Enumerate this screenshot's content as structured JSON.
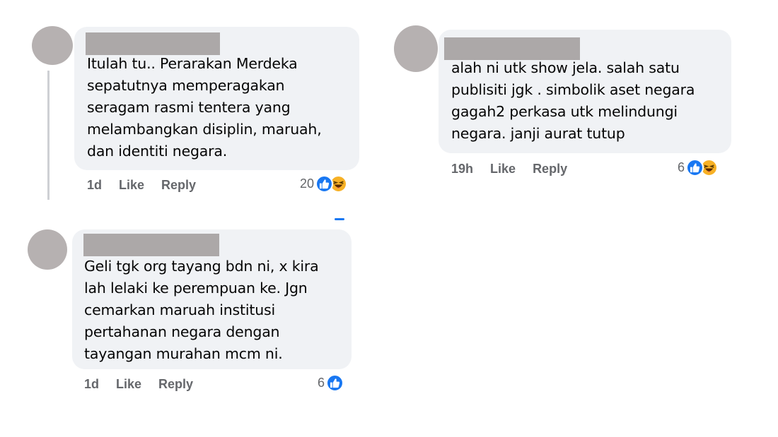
{
  "comments": [
    {
      "text_lines": [
        "Itulah tu.. Perarakan Merdeka",
        "sepatutnya memperagakan",
        "seragam rasmi tentera yang",
        "melambangkan disiplin, maruah,",
        "dan identiti negara."
      ],
      "time": "1d",
      "like_label": "Like",
      "reply_label": "Reply",
      "reaction_count": "20",
      "reactions": [
        "like-icon",
        "haha-icon"
      ]
    },
    {
      "text_lines": [
        "alah ni utk show jela. salah satu",
        "publisiti jgk . simbolik aset negara",
        "gagah2 perkasa utk melindungi",
        "negara. janji aurat tutup"
      ],
      "time": "19h",
      "like_label": "Like",
      "reply_label": "Reply",
      "reaction_count": "6",
      "reactions": [
        "like-icon",
        "haha-icon"
      ]
    },
    {
      "text_lines": [
        "Geli tgk org tayang bdn ni, x kira",
        "lah lelaki ke perempuan ke. Jgn",
        "cemarkan maruah institusi",
        "pertahanan negara dengan",
        "tayangan murahan mcm ni."
      ],
      "time": "1d",
      "like_label": "Like",
      "reply_label": "Reply",
      "reaction_count": "6",
      "reactions": [
        "like-icon"
      ]
    }
  ],
  "colors": {
    "bubble": "#f0f2f5",
    "avatar": "#b6b1b1",
    "redaction": "#aca8a8",
    "meta_text": "#65676b",
    "like_blue": "#1877f2",
    "haha_yellow": "#f7b125"
  }
}
